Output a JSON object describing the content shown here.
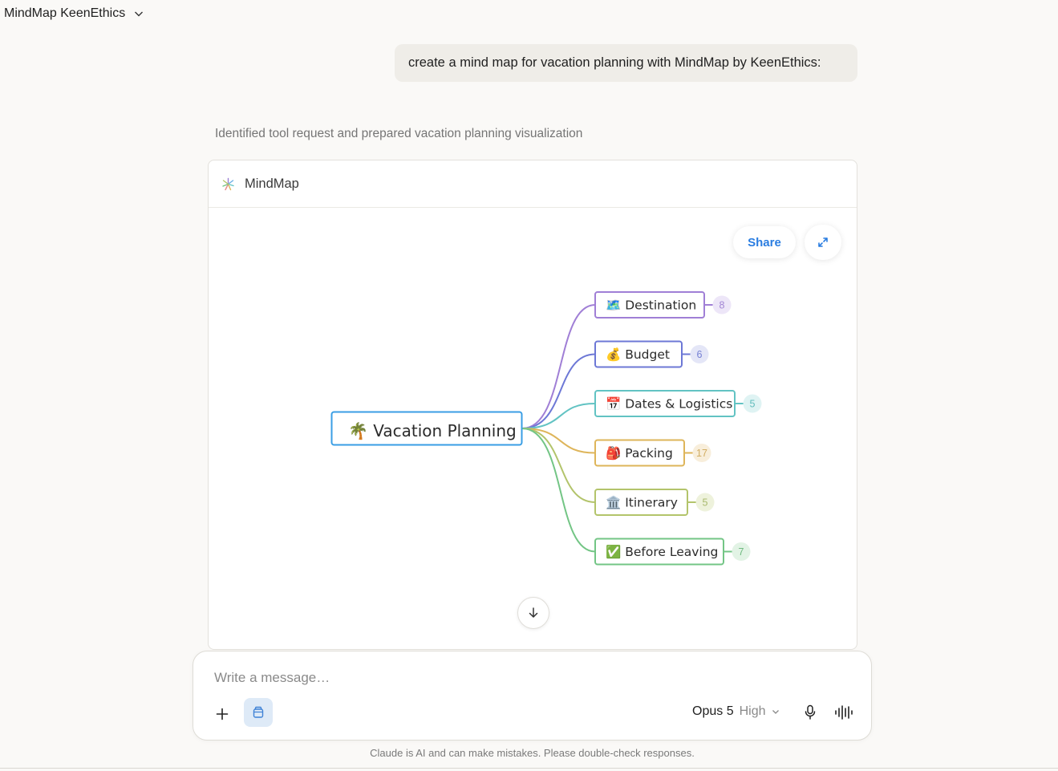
{
  "header": {
    "title": "MindMap KeenEthics"
  },
  "conversation": {
    "user_message": "create a mind map for vacation planning with MindMap by KeenEthics:",
    "thinking_summary": "Identified tool request and prepared vacation planning visualization"
  },
  "widget": {
    "title": "MindMap",
    "share_label": "Share",
    "root": {
      "emoji": "🌴",
      "label": "Vacation Planning",
      "color": "#3a9ee4"
    },
    "branches": [
      {
        "emoji": "🗺️",
        "label": "Destination",
        "count": "8",
        "color": "#a07fd6",
        "badge_bg": "#ede6f8",
        "badge_fg": "#a386d4"
      },
      {
        "emoji": "💰",
        "label": "Budget",
        "count": "6",
        "color": "#6d78d6",
        "badge_bg": "#e4e6f7",
        "badge_fg": "#7681d4"
      },
      {
        "emoji": "📅",
        "label": "Dates & Logistics",
        "count": "5",
        "color": "#62c3c3",
        "badge_bg": "#dff3f3",
        "badge_fg": "#62bcbc"
      },
      {
        "emoji": "🎒",
        "label": "Packing",
        "count": "17",
        "color": "#deb55a",
        "badge_bg": "#f8eedb",
        "badge_fg": "#d2ad62"
      },
      {
        "emoji": "🏛️",
        "label": "Itinerary",
        "count": "5",
        "color": "#b3c46b",
        "badge_bg": "#eef2dc",
        "badge_fg": "#a9b96d"
      },
      {
        "emoji": "✅",
        "label": "Before Leaving",
        "count": "7",
        "color": "#73c585",
        "badge_bg": "#e2f3e5",
        "badge_fg": "#70ba80"
      }
    ]
  },
  "composer": {
    "placeholder": "Write a message…",
    "model": "Opus 5",
    "effort": "High"
  },
  "footer": {
    "disclaimer": "Claude is AI and can make mistakes. Please double-check responses."
  }
}
